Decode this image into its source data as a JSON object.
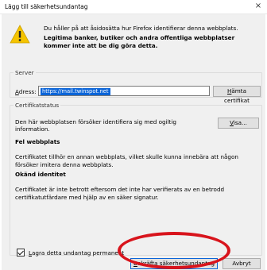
{
  "window": {
    "title": "Lägg till säkerhetsundantag",
    "close_glyph": "×"
  },
  "intro": {
    "line1": "Du håller på att åsidosätta hur Firefox identifierar denna webbplats.",
    "line2": "Legitima banker, butiker och andra offentliga webbplatser kommer inte att be dig göra detta."
  },
  "server": {
    "legend": "Server",
    "address_label": "Adress:",
    "address_value": "https://mail.twinspot.net",
    "fetch_button": "Hämta certifikat"
  },
  "cert_status": {
    "legend": "Certifikatstatus",
    "info": "Den här webbplatsen försöker identifiera sig med ogiltig information.",
    "view_button": "Visa...",
    "wrong_site_heading": "Fel webbplats",
    "wrong_site_text": "Certifikatet tillhör en annan webbplats, vilket skulle kunna innebära att någon försöker imitera denna webbplats.",
    "unknown_identity_heading": "Okänd identitet",
    "unknown_identity_text": "Certifikatet är inte betrott eftersom det inte har verifierats av en betrodd certifikatutfärdare med hjälp av en säker signatur."
  },
  "permanent": {
    "label": "Lagra detta undantag permanent",
    "checked": true
  },
  "buttons": {
    "confirm": "Bekräfta säkerhetsundantag",
    "cancel": "Avbryt"
  },
  "colors": {
    "selection": "#0a64d8",
    "annotation_ring": "#d8141c",
    "dialog_bg": "#f0f0f0"
  },
  "icons": {
    "warning": "warning-icon"
  }
}
